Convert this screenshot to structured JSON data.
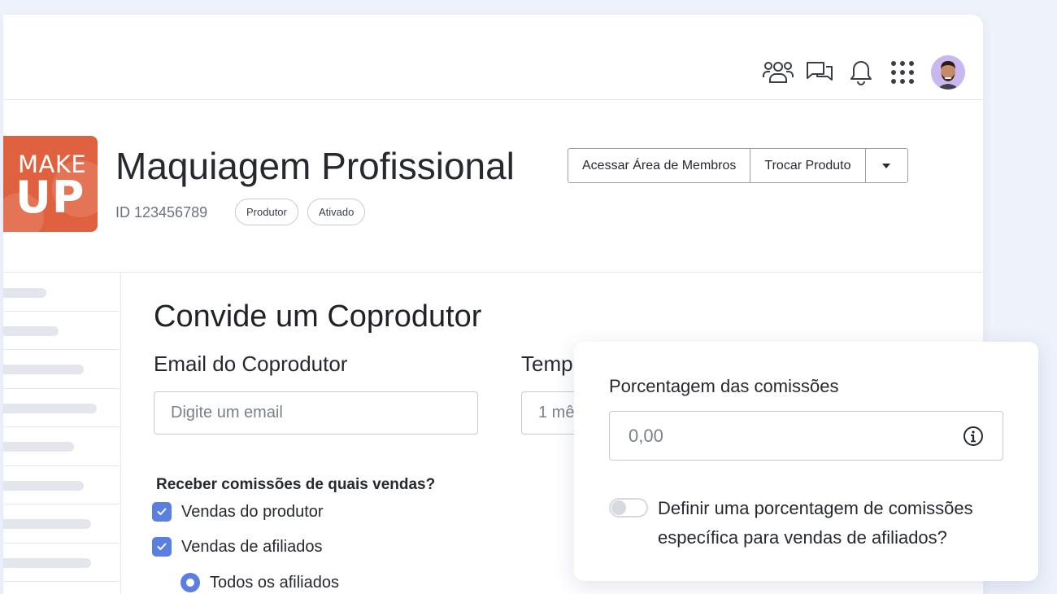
{
  "header": {
    "icons": [
      "users-icon",
      "chat-icon",
      "bell-icon",
      "apps-grid-icon"
    ],
    "avatar": "user-avatar"
  },
  "product": {
    "logo_line1": "MAKE",
    "logo_line2": "UP",
    "title": "Maquiagem Profissional",
    "id_text": "ID 123456789",
    "badges": [
      "Produtor",
      "Ativado"
    ],
    "buttons": {
      "members_area": "Acessar Área de Membros",
      "switch_product": "Trocar Produto",
      "dropdown": "chevron-down-icon"
    }
  },
  "form": {
    "title": "Convide um Coprodutor",
    "email_label": "Email do Coprodutor",
    "email_placeholder": "Digite um email",
    "time_label": "Temp",
    "time_value": "1 mê",
    "question": "Receber comissões de quais vendas?",
    "options": [
      {
        "label": "Vendas do produtor",
        "checked": true
      },
      {
        "label": "Vendas de afiliados",
        "checked": true
      }
    ],
    "radio_option": {
      "label": "Todos os afiliados",
      "selected": true
    }
  },
  "popup": {
    "label": "Porcentagem das comissões",
    "input_placeholder": "0,00",
    "toggle_text": "Definir uma porcentagem de comissões específica para vendas de afiliados?",
    "toggle_on": false
  },
  "colors": {
    "accent": "#5b7fe0",
    "logo_bg": "#e0613f",
    "page_bg": "#eef2fb"
  }
}
